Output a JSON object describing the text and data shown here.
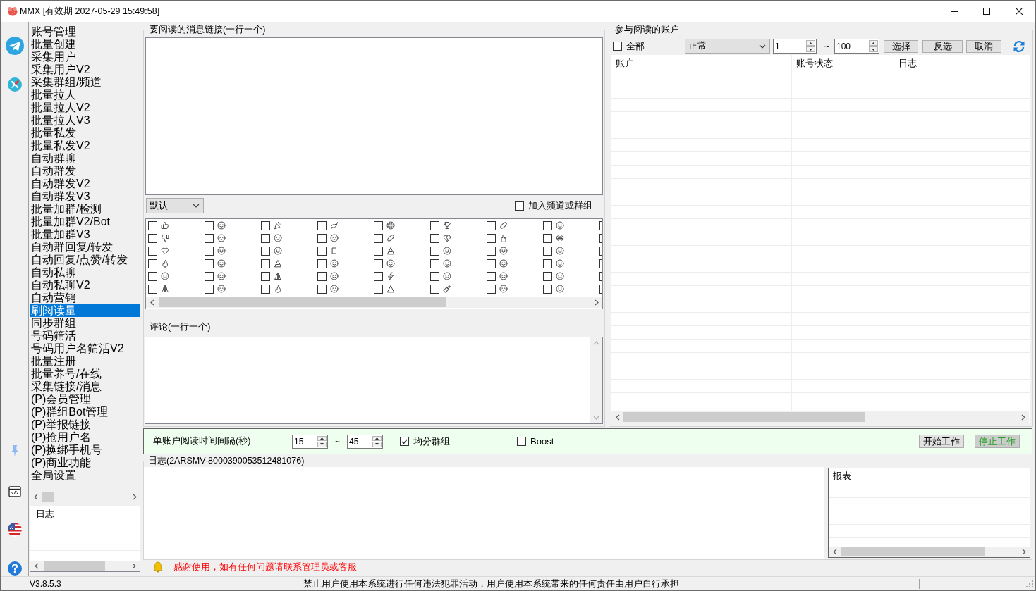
{
  "window": {
    "title": "MMX [有效期 2027-05-29 15:49:58]"
  },
  "sidebar": {
    "items": [
      {
        "label": "账号管理",
        "selected": false
      },
      {
        "label": "批量创建",
        "selected": false
      },
      {
        "label": "采集用户",
        "selected": false
      },
      {
        "label": "采集用户V2",
        "selected": false
      },
      {
        "label": "采集群组/频道",
        "selected": false
      },
      {
        "label": "批量拉人",
        "selected": false
      },
      {
        "label": "批量拉人V2",
        "selected": false
      },
      {
        "label": "批量拉人V3",
        "selected": false
      },
      {
        "label": "批量私发",
        "selected": false
      },
      {
        "label": "批量私发V2",
        "selected": false
      },
      {
        "label": "自动群聊",
        "selected": false
      },
      {
        "label": "自动群发",
        "selected": false
      },
      {
        "label": "自动群发V2",
        "selected": false
      },
      {
        "label": "自动群发V3",
        "selected": false
      },
      {
        "label": "批量加群/检测",
        "selected": false
      },
      {
        "label": "批量加群V2/Bot",
        "selected": false
      },
      {
        "label": "批量加群V3",
        "selected": false
      },
      {
        "label": "自动群回复/转发",
        "selected": false
      },
      {
        "label": "自动回复/点赞/转发",
        "selected": false
      },
      {
        "label": "自动私聊",
        "selected": false
      },
      {
        "label": "自动私聊V2",
        "selected": false
      },
      {
        "label": "自动营销",
        "selected": false
      },
      {
        "label": "刷阅读量",
        "selected": true
      },
      {
        "label": "同步群组",
        "selected": false
      },
      {
        "label": "号码筛活",
        "selected": false
      },
      {
        "label": "号码用户名筛活V2",
        "selected": false
      },
      {
        "label": "批量注册",
        "selected": false
      },
      {
        "label": "批量养号/在线",
        "selected": false
      },
      {
        "label": "采集链接/消息",
        "selected": false
      },
      {
        "label": "(P)会员管理",
        "selected": false
      },
      {
        "label": "(P)群组Bot管理",
        "selected": false
      },
      {
        "label": "(P)举报链接",
        "selected": false
      },
      {
        "label": "(P)抢用户名",
        "selected": false
      },
      {
        "label": "(P)换绑手机号",
        "selected": false
      },
      {
        "label": "(P)商业功能",
        "selected": false
      },
      {
        "label": "全局设置",
        "selected": false
      }
    ],
    "log_list": {
      "header": "日志"
    }
  },
  "links_panel": {
    "title": "要阅读的消息链接(一行一个)",
    "mode_select": {
      "value": "默认"
    },
    "join_option": {
      "label": "加入频道或群组",
      "checked": false
    },
    "reactions": [
      [
        {
          "kind": "thumbsup",
          "checked": false
        },
        {
          "kind": "face",
          "checked": false
        },
        {
          "kind": "party",
          "checked": false
        },
        {
          "kind": "bird",
          "checked": false
        },
        {
          "kind": "ball",
          "checked": false
        },
        {
          "kind": "trophy",
          "checked": false
        },
        {
          "kind": "oval",
          "checked": false
        },
        {
          "kind": "face",
          "checked": false
        },
        {
          "checked": false
        }
      ],
      [
        {
          "kind": "thumbsdown",
          "checked": false
        },
        {
          "kind": "face",
          "checked": false
        },
        {
          "kind": "face",
          "checked": false
        },
        {
          "kind": "face",
          "checked": false
        },
        {
          "kind": "oval",
          "checked": false
        },
        {
          "kind": "brokenheart",
          "checked": false
        },
        {
          "kind": "hand",
          "checked": false
        },
        {
          "kind": "eyes",
          "checked": false
        },
        {
          "checked": false
        }
      ],
      [
        {
          "kind": "heart",
          "checked": false
        },
        {
          "kind": "face",
          "checked": false
        },
        {
          "kind": "face",
          "checked": false
        },
        {
          "kind": "box",
          "checked": false
        },
        {
          "kind": "glyph",
          "checked": false
        },
        {
          "kind": "face",
          "checked": false
        },
        {
          "kind": "face",
          "checked": false
        },
        {
          "kind": "face",
          "checked": false
        },
        {
          "checked": false
        }
      ],
      [
        {
          "kind": "fire",
          "checked": false
        },
        {
          "kind": "face",
          "checked": false
        },
        {
          "kind": "glyph",
          "checked": false
        },
        {
          "kind": "face",
          "checked": false
        },
        {
          "kind": "face",
          "checked": false
        },
        {
          "kind": "face",
          "checked": false
        },
        {
          "kind": "face",
          "checked": false
        },
        {
          "kind": "face",
          "checked": false
        },
        {
          "checked": false
        }
      ],
      [
        {
          "kind": "face",
          "checked": false
        },
        {
          "kind": "face",
          "checked": false
        },
        {
          "kind": "hands",
          "checked": false
        },
        {
          "kind": "face",
          "checked": false
        },
        {
          "kind": "bolt",
          "checked": false
        },
        {
          "kind": "face",
          "checked": false
        },
        {
          "kind": "face",
          "checked": false
        },
        {
          "kind": "face",
          "checked": false
        },
        {
          "checked": false
        }
      ],
      [
        {
          "kind": "hands",
          "checked": false
        },
        {
          "kind": "face",
          "checked": false
        },
        {
          "kind": "fire",
          "checked": false
        },
        {
          "kind": "face",
          "checked": false
        },
        {
          "kind": "glyph",
          "checked": false
        },
        {
          "kind": "bottle",
          "checked": false
        },
        {
          "kind": "face",
          "checked": false
        },
        {
          "kind": "face",
          "checked": false
        },
        {
          "checked": false
        }
      ]
    ],
    "comment_label": "评论(一行一个)"
  },
  "accounts_panel": {
    "title": "参与阅读的账户",
    "all_option": {
      "label": "全部",
      "checked": false
    },
    "status_select": {
      "value": "正常"
    },
    "range_from": "1",
    "range_separator": "~",
    "range_to": "100",
    "buttons": [
      "选择",
      "反选",
      "取消"
    ],
    "table": {
      "columns": [
        "账户",
        "账号状态",
        "日志"
      ]
    }
  },
  "settings_bar": {
    "interval_label": "单账户阅读时间间隔(秒)",
    "interval_min": "15",
    "interval_separator": "~",
    "interval_max": "45",
    "options": [
      {
        "label": "均分群组",
        "checked": true
      },
      {
        "label": "Boost",
        "checked": false
      }
    ],
    "buttons": [
      {
        "label": "开始工作",
        "color": "#000000",
        "highlighted": false
      },
      {
        "label": "停止工作",
        "color": "#22a022",
        "highlighted": true
      }
    ]
  },
  "log": {
    "title": "日志(2ARSMV-8000390053512481076)",
    "report": {
      "header": "报表"
    }
  },
  "notice": "感谢使用，如有任何问题请联系管理员或客服",
  "status_bar": {
    "version": "V3.8.5.3",
    "message": "禁止用户使用本系统进行任何违法犯罪活动，用户使用本系统带来的任何责任由用户自行承担"
  }
}
